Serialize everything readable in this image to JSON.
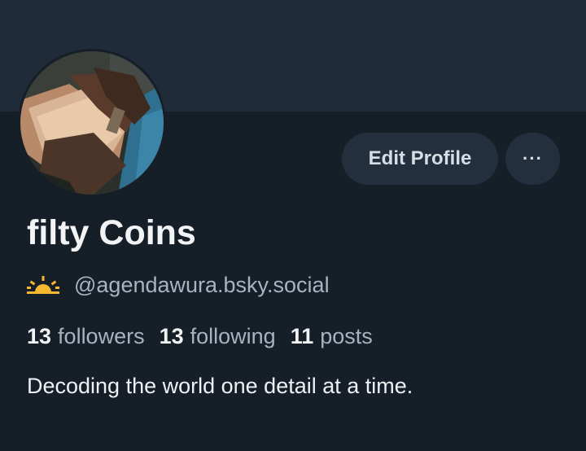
{
  "profile": {
    "display_name": "filty Coins",
    "handle": "@agendawura.bsky.social",
    "bio": "Decoding the world one detail at a time.",
    "badge_icon": "sunrise-icon"
  },
  "actions": {
    "edit_profile_label": "Edit Profile",
    "more_label": "···"
  },
  "stats": {
    "followers_count": "13",
    "followers_label": "followers",
    "following_count": "13",
    "following_label": "following",
    "posts_count": "11",
    "posts_label": "posts"
  },
  "colors": {
    "background": "#161e27",
    "banner": "#1f2b38",
    "button_bg": "#232f3d",
    "badge_accent": "#f5b82e"
  }
}
